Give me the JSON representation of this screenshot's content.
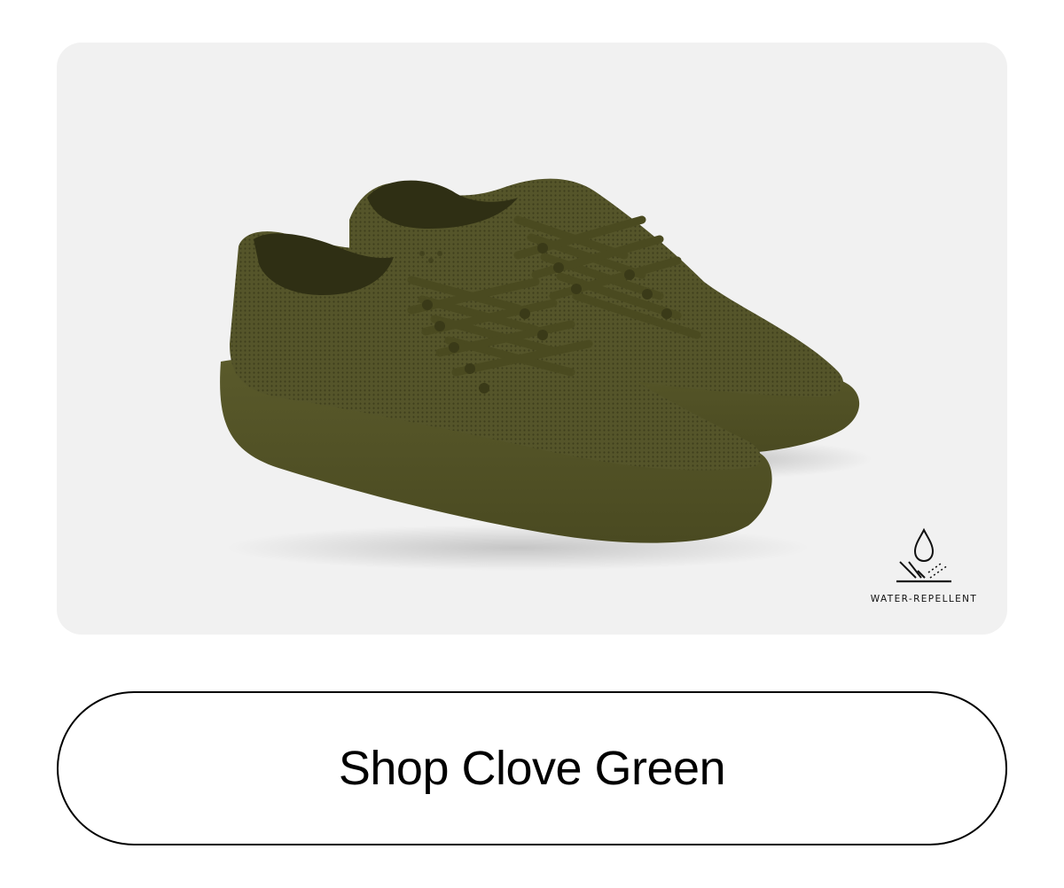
{
  "product_card": {
    "image_alt": "Pair of knit sneakers in Clove Green",
    "shoe_color": "#4f4f22",
    "sole_color": "#545428",
    "background_color": "#f1f1f1",
    "badge": {
      "icon": "water-drop-repellent-icon",
      "label": "WATER-REPELLENT"
    }
  },
  "cta": {
    "label": "Shop Clove Green"
  }
}
